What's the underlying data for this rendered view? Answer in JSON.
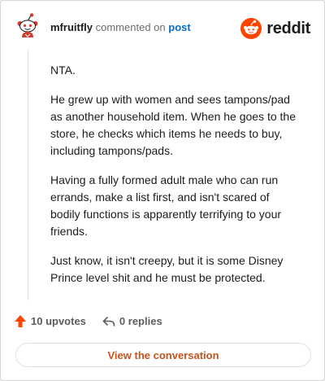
{
  "header": {
    "username": "mfruitfly",
    "action_text": "commented on",
    "post_link": "post"
  },
  "logo": {
    "text": "reddit",
    "icon": "reddit-snoo-icon",
    "color": "#ff4500"
  },
  "comment": {
    "paragraphs": [
      "NTA.",
      "He grew up with women and sees tampons/pad as another household item. When he goes to the store, he checks which items he needs to buy, including tampons/pads.",
      "Having a fully formed adult male who can run errands, make a list first, and isn't scared of bodily functions is apparently terrifying to your friends.",
      "Just know, it isn't creepy, but it is some Disney Prince level shit and he must be protected."
    ]
  },
  "actions": {
    "upvotes_label": "10 upvotes",
    "upvote_icon": "upvote-arrow-icon",
    "upvote_color": "#ff4500",
    "replies_label": "0 replies",
    "reply_icon": "reply-arrow-icon"
  },
  "view_button": {
    "label": "View the conversation",
    "color": "#c4521d"
  }
}
